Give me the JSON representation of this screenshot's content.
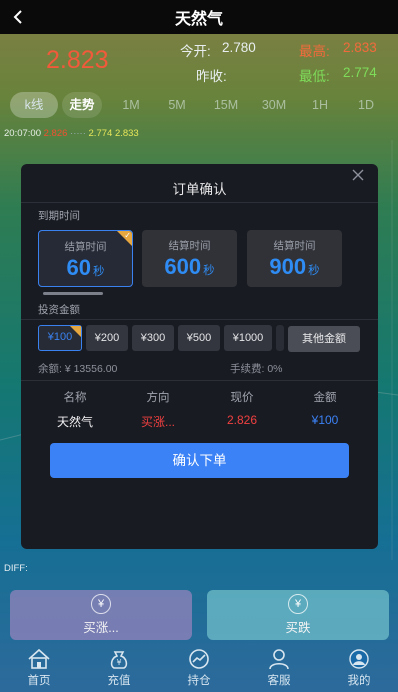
{
  "header": {
    "title": "天然气",
    "back_icon": "chevron-left-icon"
  },
  "quote": {
    "price": "2.823",
    "open_label": "今开:",
    "open_value": "2.780",
    "high_label": "最高:",
    "high_value": "2.833",
    "prev_close_label": "昨收:",
    "prev_close_value": "",
    "low_label": "最低:",
    "low_value": "2.774"
  },
  "period_tabs": [
    "k线",
    "走势",
    "1M",
    "5M",
    "15M",
    "30M",
    "1H",
    "1D"
  ],
  "chart_info": {
    "time": "20:07:00",
    "v1": "2.826",
    "v2": "2.774",
    "v3": "2.833"
  },
  "diff_label": "DIFF:",
  "actions": {
    "buy_up": "买涨...",
    "buy_down": "买跌"
  },
  "tabbar": [
    {
      "label": "首页",
      "icon": "home-icon"
    },
    {
      "label": "充值",
      "icon": "money-bag-icon"
    },
    {
      "label": "持仓",
      "icon": "chart-icon"
    },
    {
      "label": "客服",
      "icon": "person-icon"
    },
    {
      "label": "我的",
      "icon": "user-profile-icon"
    }
  ],
  "modal": {
    "title": "订单确认",
    "expiry_label": "到期时间",
    "durations": [
      {
        "caption": "结算时间",
        "value": "60",
        "unit": "秒",
        "selected": true
      },
      {
        "caption": "结算时间",
        "value": "600",
        "unit": "秒",
        "selected": false
      },
      {
        "caption": "结算时间",
        "value": "900",
        "unit": "秒",
        "selected": false
      }
    ],
    "amount_label": "投资金额",
    "amounts": [
      "¥100",
      "¥200",
      "¥300",
      "¥500",
      "¥1000"
    ],
    "other_amount": "其他金额",
    "balance_label": "余额: ¥ 13556.00",
    "fee_label": "手续费: 0%",
    "table_headers": [
      "名称",
      "方向",
      "现价",
      "金额"
    ],
    "order": {
      "name": "天然气",
      "direction": "买涨...",
      "price": "2.826",
      "amount": "¥100"
    },
    "confirm_label": "确认下单",
    "colors": {
      "accent": "#3b82f6",
      "up": "#f04040",
      "selected_tick": "#e6a640"
    }
  }
}
